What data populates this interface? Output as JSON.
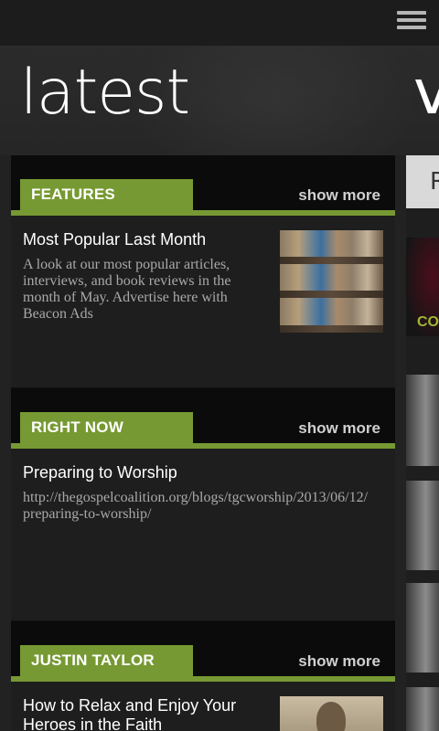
{
  "app": {
    "page_title": "latest",
    "next_pivot_title": "v",
    "menu_icon": "hamburger-menu-icon"
  },
  "sections": [
    {
      "tag": "FEATURES",
      "show_more": "show more",
      "item": {
        "title": "Most Popular Last Month",
        "description": "A look at our most popular articles, interviews, and book reviews in the month of May. Advertise here with Beacon Ads"
      }
    },
    {
      "tag": "RIGHT NOW",
      "show_more": "show more",
      "item": {
        "title": "Preparing to Worship",
        "description": "http://thegospelcoalition.org/blogs/tgcworship/2013/06/12/preparing-to-worship/"
      }
    },
    {
      "tag": "JUSTIN TAYLOR",
      "show_more": "show more",
      "item": {
        "title": "How to Relax and Enjoy Your Heroes in the Faith",
        "description": ""
      }
    }
  ],
  "side_column": {
    "button_label": "R",
    "tile_text": "CO"
  },
  "colors": {
    "accent_green": "#779933",
    "background": "#222222",
    "panel": "#1e1e1e"
  }
}
